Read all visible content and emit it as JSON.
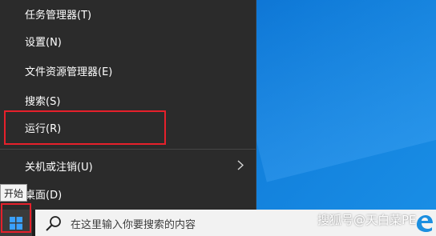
{
  "context_menu": {
    "items": [
      {
        "label": "任务管理器(T)"
      },
      {
        "label": "设置(N)"
      },
      {
        "label": "文件资源管理器(E)"
      },
      {
        "label": "搜索(S)"
      },
      {
        "label": "运行(R)"
      },
      {
        "label": "关机或注销(U)",
        "submenu_icon": "chevron-right-icon"
      },
      {
        "label": "桌面(D)"
      }
    ],
    "highlighted_item": "运行(R)"
  },
  "taskbar": {
    "start_tooltip": "开始",
    "search_placeholder": "在这里输入你要搜索的内容",
    "start_icon": "windows-logo-icon",
    "search_icon": "search-icon"
  },
  "watermark": {
    "text": "搜狐号@天白菜PE"
  },
  "colors": {
    "menu_background": "#2b2b2b",
    "highlight_border": "#e6202b",
    "desktop": "#0f7ad8"
  }
}
